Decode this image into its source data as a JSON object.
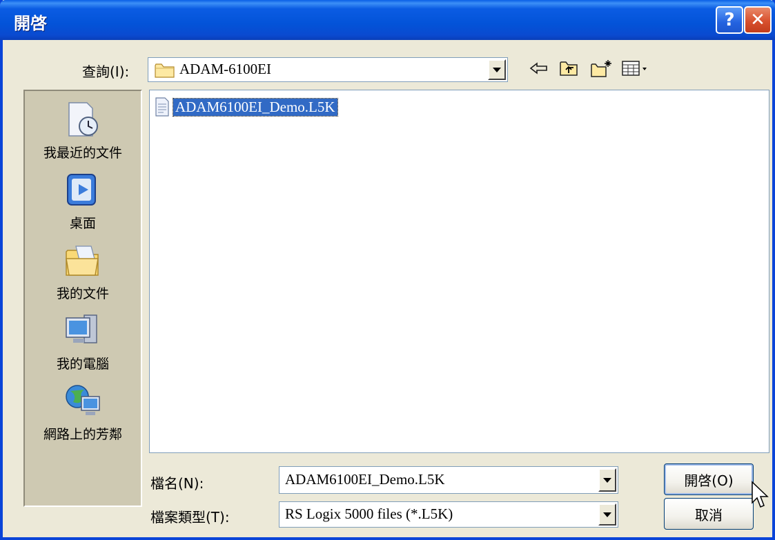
{
  "window": {
    "title": "開啓",
    "help_label": "?",
    "close_label": "✕"
  },
  "lookin": {
    "label": "查詢(I):",
    "value": "ADAM-6100EI"
  },
  "toolbar": {
    "icons": [
      "back-arrow-icon",
      "up-folder-icon",
      "new-folder-icon",
      "view-menu-icon"
    ]
  },
  "places": [
    {
      "label": "我最近的文件",
      "icon": "recent-documents-icon"
    },
    {
      "label": "桌面",
      "icon": "desktop-icon"
    },
    {
      "label": "我的文件",
      "icon": "my-documents-icon"
    },
    {
      "label": "我的電腦",
      "icon": "my-computer-icon"
    },
    {
      "label": "網路上的芳鄰",
      "icon": "network-places-icon"
    }
  ],
  "files": [
    {
      "name": "ADAM6100EI_Demo.L5K",
      "selected": true
    }
  ],
  "filename": {
    "label": "檔名(N):",
    "value": "ADAM6100EI_Demo.L5K"
  },
  "filetype": {
    "label": "檔案類型(T):",
    "value": "RS Logix 5000 files (*.L5K)"
  },
  "buttons": {
    "open": "開啓(O)",
    "cancel": "取消"
  },
  "colors": {
    "titlebar": "#0353d8",
    "selection": "#316ac5",
    "dialog_bg": "#ece9d8"
  }
}
